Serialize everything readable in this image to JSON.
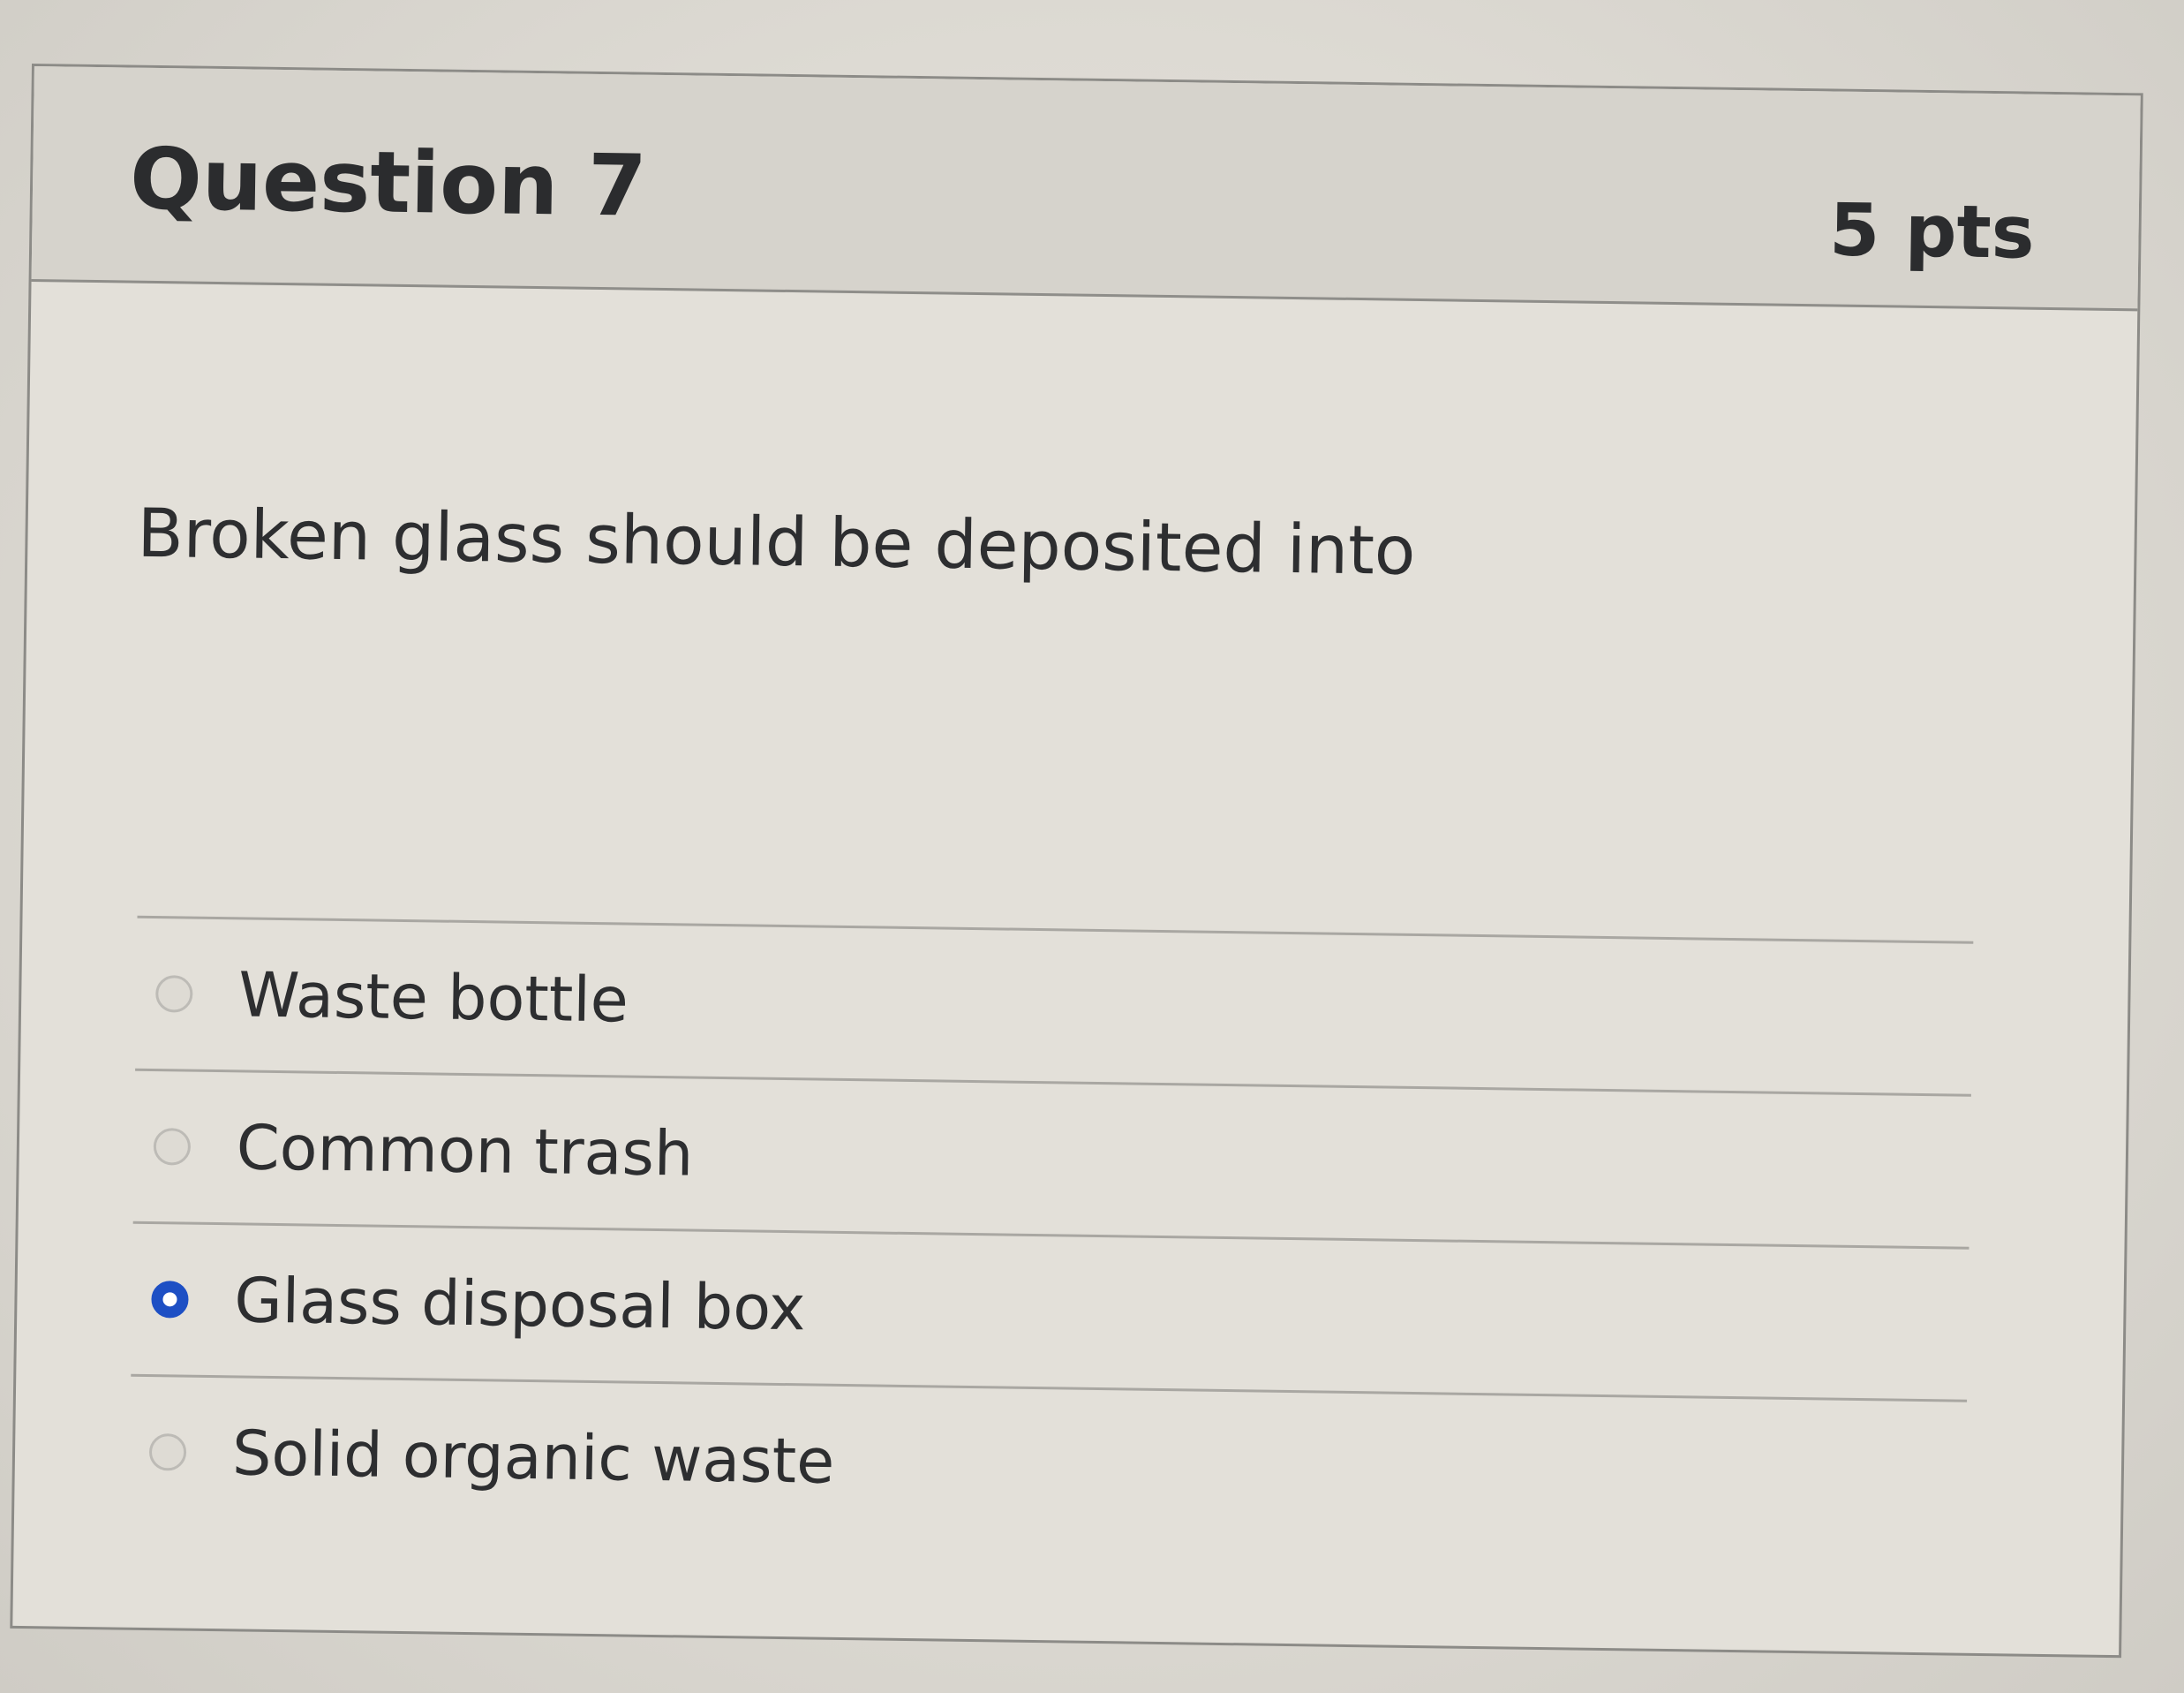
{
  "question": {
    "title": "Question 7",
    "points": "5 pts",
    "text": "Broken glass should be deposited into"
  },
  "answers": [
    {
      "label": "Waste bottle",
      "selected": false
    },
    {
      "label": "Common trash",
      "selected": false
    },
    {
      "label": "Glass disposal box",
      "selected": true
    },
    {
      "label": "Solid organic waste",
      "selected": false
    }
  ],
  "colors": {
    "selected_radio": "#1d4fc4",
    "header_background": "#d6d3cc",
    "text": "#2d2e30"
  }
}
